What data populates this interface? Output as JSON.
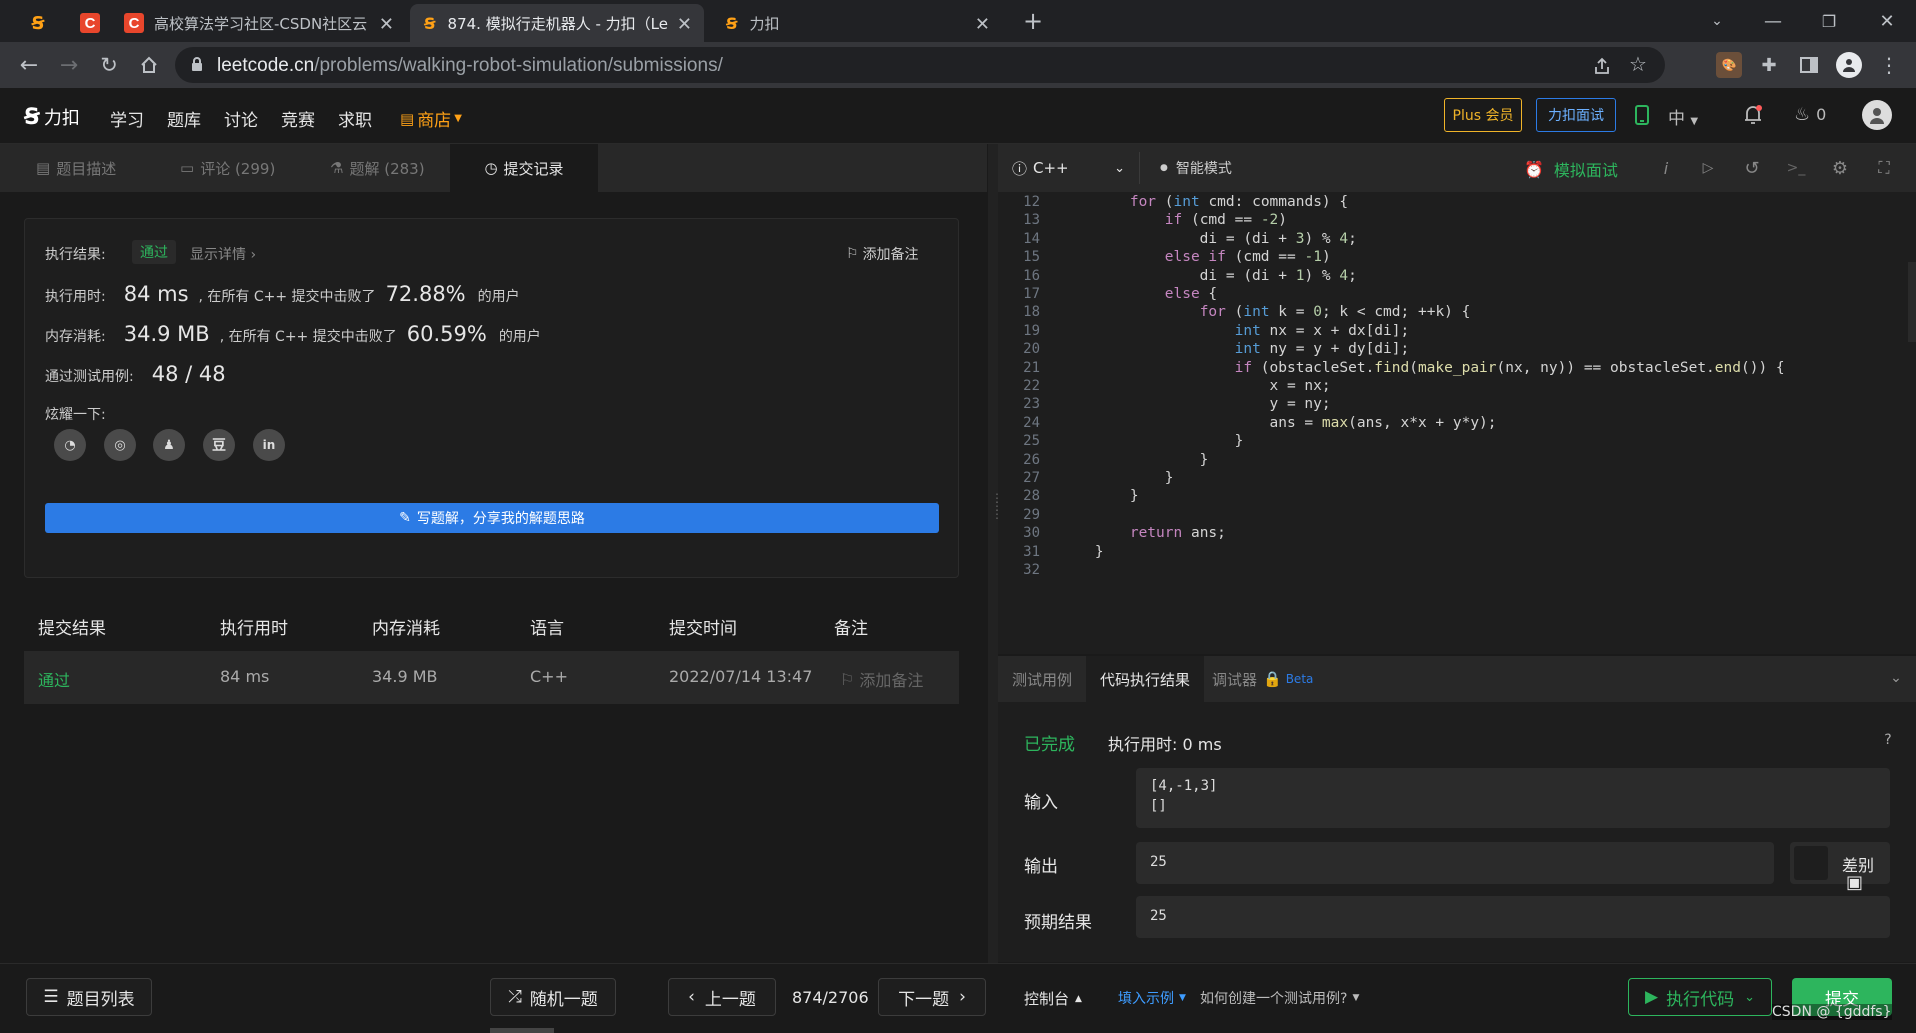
{
  "browser": {
    "tabs": [
      {
        "title": ""
      },
      {
        "title": "高校算法学习社区-CSDN社区云"
      },
      {
        "title": "874. 模拟行走机器人 - 力扣（Le"
      },
      {
        "title": "力扣"
      }
    ],
    "url_host": "leetcode.cn",
    "url_path": "/problems/walking-robot-simulation/submissions/"
  },
  "site_nav": {
    "logo_text": "力扣",
    "items": [
      "学习",
      "题库",
      "讨论",
      "竞赛",
      "求职"
    ],
    "shop": "商店",
    "plus_button": "Plus 会员",
    "interview_button": "力扣面试",
    "lang": "中",
    "points": "0"
  },
  "left_tabs": [
    {
      "label": "题目描述"
    },
    {
      "label": "评论 (299)"
    },
    {
      "label": "题解 (283)"
    },
    {
      "label": "提交记录"
    }
  ],
  "result": {
    "status_label": "执行结果:",
    "status": "通过",
    "details_link": "显示详情 ›",
    "add_note": "添加备注",
    "time_label": "执行用时:",
    "time_value": "84 ms",
    "time_beat_text": ", 在所有 C++ 提交中击败了",
    "time_percent": "72.88%",
    "users_suffix": "的用户",
    "mem_label": "内存消耗:",
    "mem_value": "34.9 MB",
    "mem_beat_text": ", 在所有 C++ 提交中击败了",
    "mem_percent": "60.59%",
    "tests_label": "通过测试用例:",
    "tests_value": "48 / 48",
    "share_label": "炫耀一下:",
    "share_icons": [
      "wechat-icon",
      "weibo-icon",
      "qq-icon",
      "douban-icon",
      "linkedin-icon"
    ],
    "write_button": "写题解，分享我的解题思路"
  },
  "submissions": {
    "headers": [
      "提交结果",
      "执行用时",
      "内存消耗",
      "语言",
      "提交时间",
      "备注"
    ],
    "rows": [
      {
        "result": "通过",
        "time": "84 ms",
        "memory": "34.9 MB",
        "lang": "C++",
        "submitted": "2022/07/14 13:47",
        "note": "添加备注"
      }
    ]
  },
  "editor": {
    "language": "C++",
    "smart_mode": "智能模式",
    "mock_interview": "模拟面试",
    "lines": [
      {
        "n": "12",
        "text": "        for (int cmd: commands) {"
      },
      {
        "n": "13",
        "text": "            if (cmd == -2)"
      },
      {
        "n": "14",
        "text": "                di = (di + 3) % 4;"
      },
      {
        "n": "15",
        "text": "            else if (cmd == -1)"
      },
      {
        "n": "16",
        "text": "                di = (di + 1) % 4;"
      },
      {
        "n": "17",
        "text": "            else {"
      },
      {
        "n": "18",
        "text": "                for (int k = 0; k < cmd; ++k) {"
      },
      {
        "n": "19",
        "text": "                    int nx = x + dx[di];"
      },
      {
        "n": "20",
        "text": "                    int ny = y + dy[di];"
      },
      {
        "n": "21",
        "text": "                    if (obstacleSet.find(make_pair(nx, ny)) == obstacleSet.end()) {"
      },
      {
        "n": "22",
        "text": "                        x = nx;"
      },
      {
        "n": "23",
        "text": "                        y = ny;"
      },
      {
        "n": "24",
        "text": "                        ans = max(ans, x*x + y*y);"
      },
      {
        "n": "25",
        "text": "                    }"
      },
      {
        "n": "26",
        "text": "                }"
      },
      {
        "n": "27",
        "text": "            }"
      },
      {
        "n": "28",
        "text": "        }"
      },
      {
        "n": "29",
        "text": ""
      },
      {
        "n": "30",
        "text": "        return ans;"
      },
      {
        "n": "31",
        "text": "    }"
      },
      {
        "n": "32",
        "text": ""
      }
    ]
  },
  "console": {
    "tabs": [
      "测试用例",
      "代码执行结果",
      "调试器"
    ],
    "beta": "Beta",
    "done": "已完成",
    "exec_time": "执行用时: 0 ms",
    "input_label": "输入",
    "input_line1": "[4,-1,3]",
    "input_line2": "[]",
    "output_label": "输出",
    "output_value": "25",
    "diff_label": "差别",
    "expected_label": "预期结果",
    "expected_value": "25"
  },
  "bottom": {
    "problem_list": "题目列表",
    "random": "随机一题",
    "prev": "上一题",
    "counter": "874/2706",
    "next": "下一题",
    "console_toggle": "控制台",
    "fill_example": "填入示例",
    "how_to": "如何创建一个测试用例?",
    "run_code": "执行代码",
    "submit": "提交",
    "watermark": "CSDN @ {gddfs}"
  },
  "colors": {
    "accent_green": "#2db55d",
    "accent_blue": "#2c7be5",
    "shop_orange": "#ffa116",
    "plus_gold": "#f0b429"
  }
}
